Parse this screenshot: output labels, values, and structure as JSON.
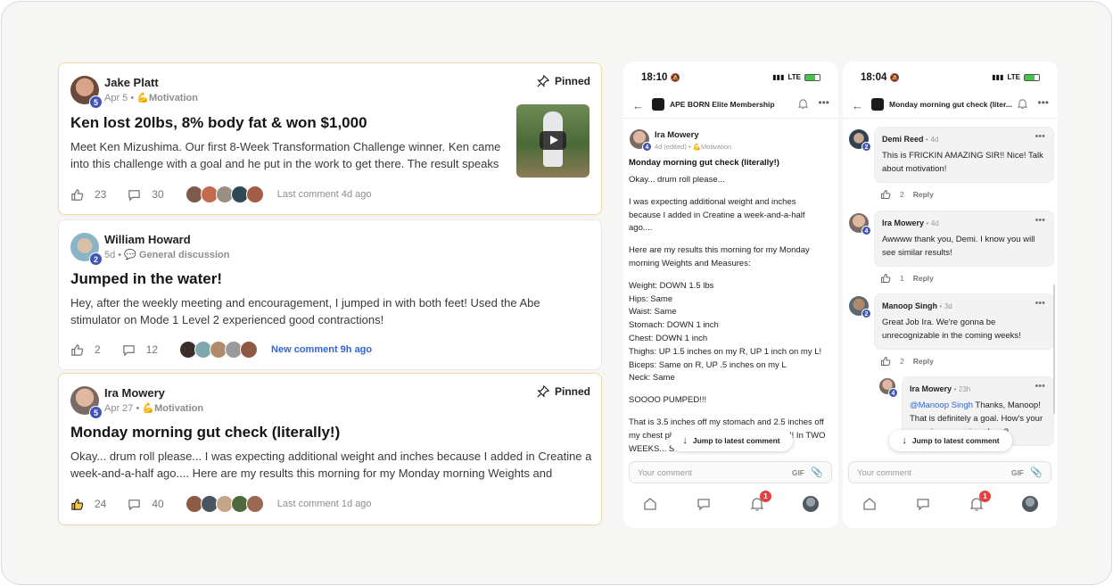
{
  "feed": {
    "posts": [
      {
        "author": "Jake Platt",
        "level": "5",
        "date": "Apr 5",
        "category_emoji": "💪",
        "category": "Motivation",
        "pinned_label": "Pinned",
        "title": "Ken lost 20lbs, 8% body fat & won $1,000",
        "body": "Meet Ken Mizushima. Our first 8-Week Transformation Challenge winner. Ken came into this challenge with a goal and he put in the work to get there. The result speaks for",
        "likes": "23",
        "comments": "30",
        "last_comment": "Last comment 4d ago"
      },
      {
        "author": "William Howard",
        "level": "2",
        "date": "5d",
        "category_emoji": "💬",
        "category": "General discussion",
        "title": "Jumped in the water!",
        "body": "Hey, after the weekly meeting and encouragement, I jumped in with both feet! Used the Abe stimulator on Mode 1 Level 2 experienced good contractions!",
        "likes": "2",
        "comments": "12",
        "last_comment": "New comment 9h ago"
      },
      {
        "author": "Ira Mowery",
        "level": "5",
        "date": "Apr 27",
        "category_emoji": "💪",
        "category": "Motivation",
        "pinned_label": "Pinned",
        "title": "Monday morning gut check (literally!)",
        "body": "Okay... drum roll please... I was expecting additional weight and inches because I added in Creatine a week-and-a-half ago.... Here are my results this morning for my Monday morning Weights and",
        "likes": "24",
        "comments": "40",
        "last_comment": "Last comment 1d ago"
      }
    ]
  },
  "phone1": {
    "time": "18:10",
    "network": "LTE",
    "title": "APE BORN Elite Membership",
    "post": {
      "author": "Ira Mowery",
      "level": "4",
      "meta": "4d (edited) •",
      "category_emoji": "💪",
      "category": "Motivation",
      "title": "Monday morning gut check (literally!)",
      "lines": [
        "Okay... drum roll please...",
        "",
        "I was expecting additional weight and inches",
        "because I added in Creatine a week-and-a-half",
        "ago....",
        "",
        "Here are my results this morning for my Monday",
        "morning Weights and Measures:",
        "",
        "Weight: DOWN 1.5 lbs",
        "Hips: Same",
        "Waist: Same",
        "Stomach: DOWN 1 inch",
        "Chest: DOWN 1 inch",
        "Thighs: UP 1.5 inches on my R, UP 1 inch on my L!",
        "Biceps: Same on R, UP .5 inches on my L",
        "Neck: Same",
        "",
        "SOOOO PUMPED!!!",
        "",
        "That is 3.5 inches off my stomach and 2.5 inches off",
        "my chest pl                                                  !! In TWO",
        "WEEKS... S"
      ]
    },
    "jump_label": "Jump to latest comment",
    "composer_placeholder": "Your comment",
    "gif_label": "GIF",
    "notif_badge": "1"
  },
  "phone2": {
    "time": "18:04",
    "network": "LTE",
    "title": "Monday morning gut check (liter...",
    "comments": [
      {
        "author": "Demi Reed",
        "level": "2",
        "age": "4d",
        "text_lines": [
          "This is FRICKIN AMAZING SIR!! Nice! Talk",
          "about motivation!"
        ],
        "likes": "2",
        "reply": "Reply"
      },
      {
        "author": "Ira Mowery",
        "level": "4",
        "age": "4d",
        "text_lines": [
          "Awwww thank you, Demi. I know you will",
          "see similar results!"
        ],
        "likes": "1",
        "reply": "Reply"
      },
      {
        "author": "Manoop Singh",
        "level": "2",
        "age": "3d",
        "text_lines": [
          "Great Job Ira. We're gonna be",
          "unrecognizable in the coming weeks!"
        ],
        "likes": "2",
        "reply": "Reply"
      },
      {
        "author": "Ira Mowery",
        "level": "4",
        "age": "23h",
        "mention": "@Manoop Singh",
        "text_first": " Thanks, Manoop!",
        "text_lines": [
          "That is definitely a goal. How's your",
          "experience coming along?"
        ]
      }
    ],
    "jump_label": "Jump to latest comment",
    "composer_placeholder": "Your comment",
    "gif_label": "GIF",
    "notif_badge": "1"
  },
  "colors": {
    "accent_blue": "#2d67d6",
    "level_badge": "#3d55b8",
    "pinned_border": "#f4d9a4",
    "notif_red": "#e64141"
  },
  "icons": [
    "pin-icon",
    "thumbs-up-icon",
    "comment-icon",
    "play-icon",
    "back-arrow-icon",
    "bell-icon",
    "more-icon",
    "home-icon",
    "chat-icon",
    "paperclip-icon",
    "arrow-down-icon"
  ]
}
